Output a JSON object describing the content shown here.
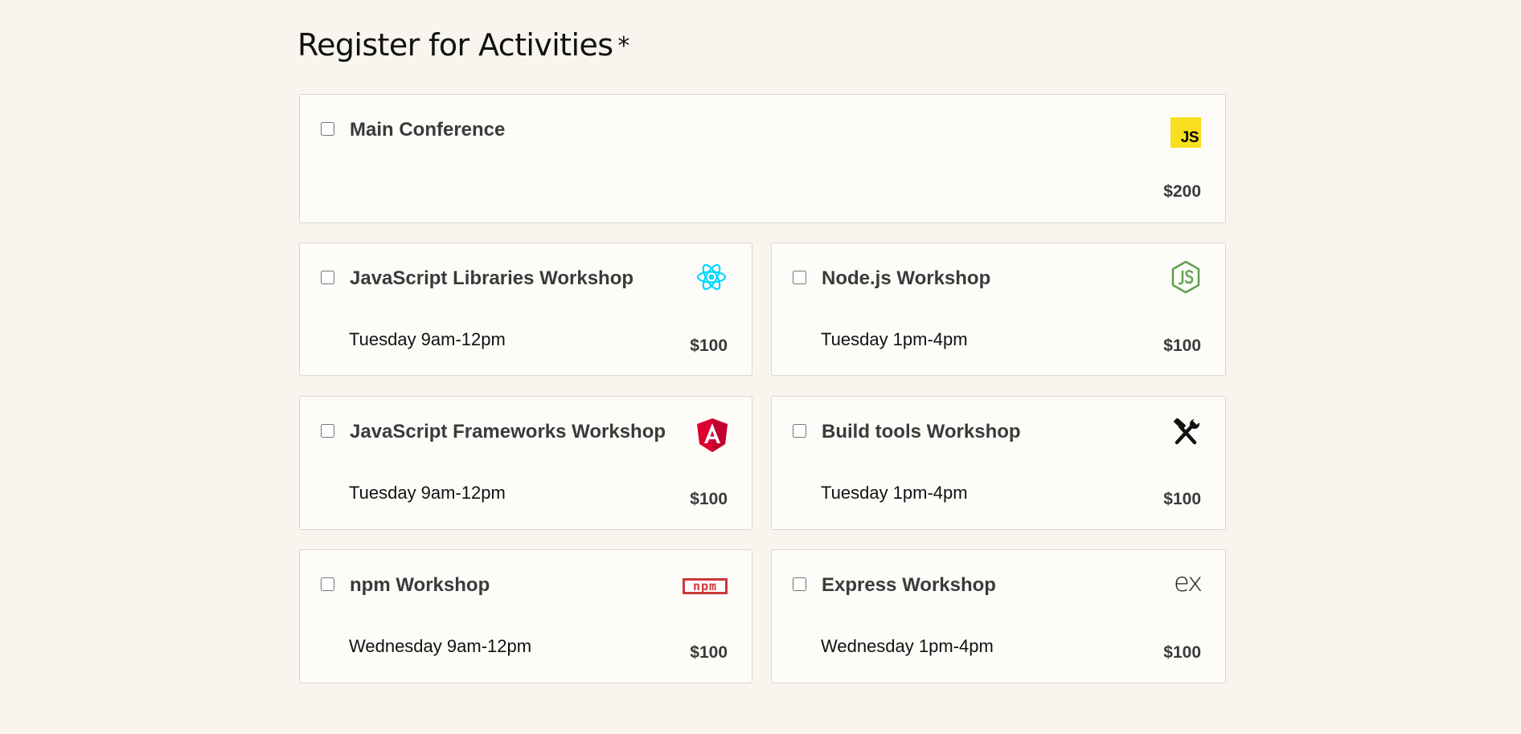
{
  "heading": {
    "text": "Register for Activities",
    "required_mark": "*"
  },
  "activities": {
    "main": {
      "name": "Main Conference",
      "price": "$200",
      "icon": "javascript-logo-icon",
      "icon_text": "JS"
    },
    "js_libraries": {
      "name": "JavaScript Libraries Workshop",
      "time": "Tuesday 9am-12pm",
      "price": "$100",
      "icon": "react-logo-icon"
    },
    "node": {
      "name": "Node.js Workshop",
      "time": "Tuesday 1pm-4pm",
      "price": "$100",
      "icon": "nodejs-logo-icon"
    },
    "js_frameworks": {
      "name": "JavaScript Frameworks Workshop",
      "time": "Tuesday 9am-12pm",
      "price": "$100",
      "icon": "angular-logo-icon"
    },
    "build_tools": {
      "name": "Build tools Workshop",
      "time": "Tuesday 1pm-4pm",
      "price": "$100",
      "icon": "hammer-wrench-icon"
    },
    "npm": {
      "name": "npm Workshop",
      "time": "Wednesday 9am-12pm",
      "price": "$100",
      "icon": "npm-logo-icon",
      "icon_text": "npm"
    },
    "express": {
      "name": "Express Workshop",
      "time": "Wednesday 1pm-4pm",
      "price": "$100",
      "icon": "express-logo-icon",
      "icon_text": "ex"
    }
  },
  "colors": {
    "page_background": "#f8f5ef",
    "card_background": "#fefcf8",
    "card_border": "#d9d6d0",
    "js_yellow": "#f7df1e",
    "react_cyan": "#00d8ff",
    "node_green": "#5fa04e",
    "angular_red": "#dd0031",
    "npm_red": "#cb3837"
  }
}
